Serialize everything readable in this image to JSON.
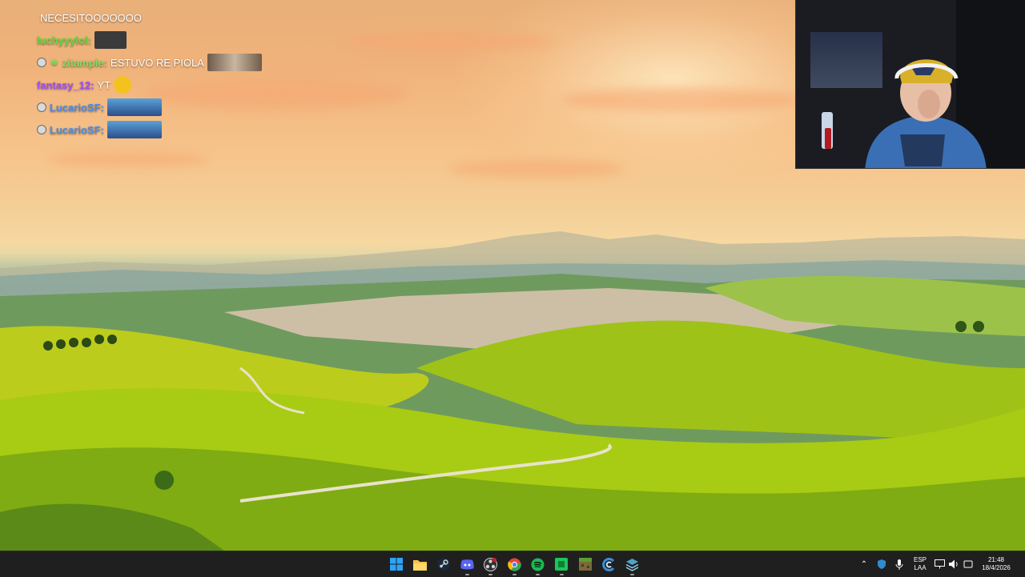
{
  "chat": {
    "messages": [
      {
        "user": "",
        "user_color": "#ffffff",
        "text": "NECESITOOOOOOO",
        "badge": false,
        "emote": false
      },
      {
        "user": "luchyyylol:",
        "user_color": "#5dde3d",
        "text": "",
        "badge": false,
        "emote": true,
        "emote_type": "cat"
      },
      {
        "user": "zitample:",
        "user_color": "#7be15c",
        "text": "ESTUVO RE PIOLA",
        "badge": true,
        "emote": true,
        "emote_type": "faces"
      },
      {
        "user": "fantasy_12:",
        "user_color": "#a24dff",
        "text": "YT",
        "badge": false,
        "emote": true,
        "emote_type": "face"
      },
      {
        "user": "LucarioSF:",
        "user_color": "#4b8ce8",
        "text": "",
        "badge": true,
        "emote": true,
        "emote_type": "car"
      },
      {
        "user": "LucarioSF:",
        "user_color": "#4b8ce8",
        "text": "",
        "badge": true,
        "emote": true,
        "emote_type": "car"
      }
    ]
  },
  "webcam": {
    "label": "streamer-webcam"
  },
  "taskbar": {
    "apps": [
      {
        "name": "start-icon",
        "color": "#2aa5ff",
        "running": false
      },
      {
        "name": "file-explorer-icon",
        "color": "#f6c34a",
        "running": false
      },
      {
        "name": "steam-icon",
        "color": "#c7d5e0",
        "running": false
      },
      {
        "name": "discord-icon",
        "color": "#5865f2",
        "running": true
      },
      {
        "name": "obs-icon",
        "color": "#d0d0d0",
        "running": true
      },
      {
        "name": "chrome-icon",
        "color": "#ea4335",
        "running": true
      },
      {
        "name": "spotify-icon",
        "color": "#1db954",
        "running": true
      },
      {
        "name": "green-app-icon",
        "color": "#1ac75a",
        "running": true
      },
      {
        "name": "minecraft-icon",
        "color": "#7a6a3a",
        "running": false
      },
      {
        "name": "ccleaner-icon",
        "color": "#3a8fd8",
        "running": false
      },
      {
        "name": "stack-app-icon",
        "color": "#4fa3c7",
        "running": true
      }
    ],
    "tray": {
      "lang_top": "ESP",
      "lang_bottom": "LAA",
      "time": "21:48",
      "date": "18/4/2026"
    }
  }
}
